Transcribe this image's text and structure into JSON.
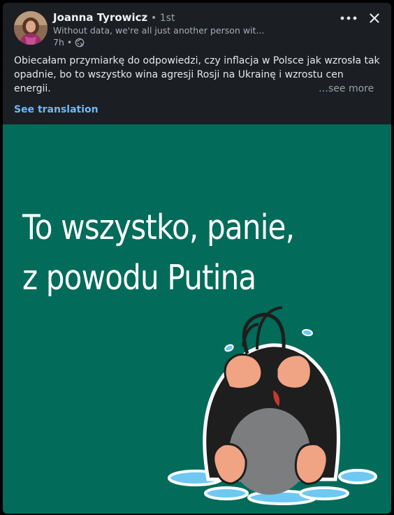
{
  "post": {
    "author": {
      "name": "Joanna Tyrowicz",
      "degree": "• 1st",
      "headline": "Without data, we're all just another person wit...",
      "time": "7h •"
    },
    "body_text": "Obiecałam przymiarkę do odpowiedzi, czy inflacja w Polsce jak wzrosła tak opadnie, bo to wszystko wina agresji Rosji na Ukrainę i wzrostu cen energii.",
    "see_more_label": "…see more",
    "see_translation_label": "See translation",
    "image": {
      "caption_line1": "To wszystko, panie,",
      "caption_line2": "z powodu Putina",
      "background_color": "#026b5a"
    }
  },
  "icons": {
    "more": "more-horizontal-icon",
    "close": "close-icon",
    "visibility": "globe-icon"
  },
  "colors": {
    "card_background": "#1b1f23",
    "link_blue": "#71b7fb",
    "text_primary": "#e6e8ea",
    "text_secondary": "#a8adb3"
  }
}
